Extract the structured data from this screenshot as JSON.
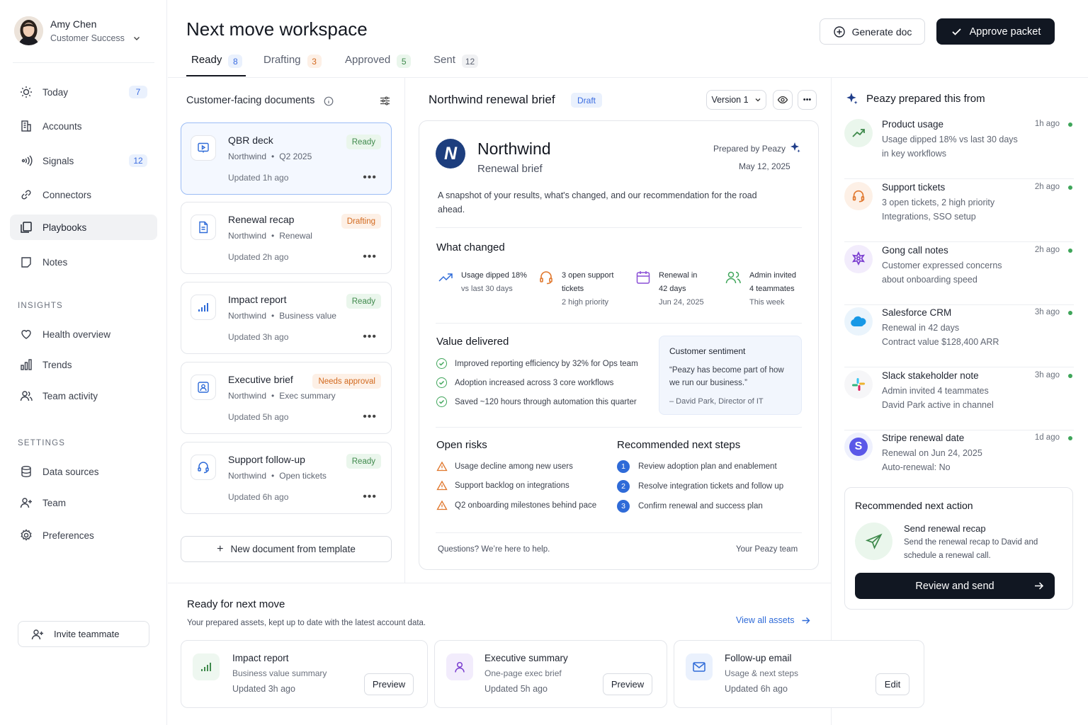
{
  "user": {
    "name": "Amy Chen",
    "role": "Customer Success"
  },
  "nav": {
    "items": [
      {
        "label": "Today",
        "badge": "7"
      },
      {
        "label": "Accounts"
      },
      {
        "label": "Signals",
        "badge": "12"
      },
      {
        "label": "Connectors"
      },
      {
        "label": "Playbooks"
      },
      {
        "label": "Notes"
      }
    ],
    "insights_label": "INSIGHTS",
    "insights": [
      {
        "label": "Health overview"
      },
      {
        "label": "Trends"
      },
      {
        "label": "Team activity"
      }
    ],
    "settings_label": "SETTINGS",
    "settings": [
      {
        "label": "Data sources"
      },
      {
        "label": "Team"
      },
      {
        "label": "Preferences"
      }
    ],
    "invite": "Invite teammate"
  },
  "header": {
    "title": "Next move workspace",
    "tabs": [
      {
        "label": "Ready",
        "count": "8"
      },
      {
        "label": "Drafting",
        "count": "3"
      },
      {
        "label": "Approved",
        "count": "5"
      },
      {
        "label": "Sent",
        "count": "12"
      }
    ],
    "generate_doc": "Generate doc",
    "approve_packet": "Approve packet"
  },
  "documents": {
    "title": "Customer-facing documents",
    "items": [
      {
        "title": "QBR deck",
        "account": "Northwind",
        "detail": "Q2 2025",
        "updated": "Updated 1h ago",
        "status": "Ready"
      },
      {
        "title": "Renewal recap",
        "account": "Northwind",
        "detail": "Renewal",
        "updated": "Updated 2h ago",
        "status": "Drafting"
      },
      {
        "title": "Impact report",
        "account": "Northwind",
        "detail": "Business value",
        "updated": "Updated 3h ago",
        "status": "Ready"
      },
      {
        "title": "Executive brief",
        "account": "Northwind",
        "detail": "Exec summary",
        "updated": "Updated 5h ago",
        "status": "Needs approval"
      },
      {
        "title": "Support follow-up",
        "account": "Northwind",
        "detail": "Open tickets",
        "updated": "Updated 6h ago",
        "status": "Ready"
      }
    ],
    "new_doc": "New document from template"
  },
  "brief": {
    "title": "Northwind renewal brief",
    "badge": "Draft",
    "version": "Version 1",
    "company": "Northwind",
    "company_initial": "N",
    "subtitle": "Renewal brief",
    "prepared_by": "Prepared by Peazy",
    "date": "May 12, 2025",
    "intro": "A snapshot of your results, what's changed, and our recommendation for the road ahead.",
    "what_changed_title": "What changed",
    "changes": [
      {
        "l1": "Usage dipped 18%",
        "l2": "vs last 30 days",
        "l3": ""
      },
      {
        "l1": "3 open support",
        "l2": "tickets",
        "l3": "2 high priority"
      },
      {
        "l1": "Renewal in",
        "l2": "42 days",
        "l3": "Jun 24, 2025"
      },
      {
        "l1": "Admin invited",
        "l2": "4 teammates",
        "l3": "This week"
      }
    ],
    "value_title": "Value delivered",
    "value": [
      "Improved reporting efficiency by 32% for Ops team",
      "Adoption increased across 3 core workflows",
      "Saved ~120 hours through automation this quarter"
    ],
    "sentiment_title": "Customer sentiment",
    "sentiment_quote_1": "“Peazy has become part of how",
    "sentiment_quote_2": "we run our business.”",
    "sentiment_author": "– David Park, Director of IT",
    "risks_title": "Open risks",
    "risks": [
      "Usage decline among new users",
      "Support backlog on integrations",
      "Q2 onboarding milestones behind pace"
    ],
    "steps_title": "Recommended next steps",
    "steps": [
      {
        "n": "1",
        "text": "Review adoption plan and enablement"
      },
      {
        "n": "2",
        "text": "Resolve integration tickets and follow up"
      },
      {
        "n": "3",
        "text": "Confirm renewal and success plan"
      }
    ],
    "footer_left": "Questions? We’re here to help.",
    "footer_right": "Your Peazy team"
  },
  "sources": {
    "title": "Peazy prepared this from",
    "items": [
      {
        "title": "Product usage",
        "l1": "Usage dipped 18% vs last 30 days",
        "l2": "in key workflows",
        "time": "1h ago"
      },
      {
        "title": "Support tickets",
        "l1": "3 open tickets, 2 high priority",
        "l2": "Integrations, SSO setup",
        "time": "2h ago"
      },
      {
        "title": "Gong call notes",
        "l1": "Customer expressed concerns",
        "l2": "about onboarding speed",
        "time": "2h ago"
      },
      {
        "title": "Salesforce CRM",
        "l1": "Renewal in 42 days",
        "l2": "Contract value $128,400 ARR",
        "time": "3h ago"
      },
      {
        "title": "Slack stakeholder note",
        "l1": "Admin invited 4 teammates",
        "l2": "David Park active in channel",
        "time": "3h ago"
      },
      {
        "title": "Stripe renewal date",
        "l1": "Renewal on Jun 24, 2025",
        "l2": "Auto-renewal: No",
        "time": "1d ago"
      }
    ],
    "stripe_letter": "S"
  },
  "recommended": {
    "title": "Recommended next action",
    "action_title": "Send renewal recap",
    "action_l1": "Send the renewal recap to David and",
    "action_l2": "schedule a renewal call.",
    "button": "Review and send"
  },
  "ready": {
    "title": "Ready for next move",
    "subtitle": "Your prepared assets, kept up to date with the latest account data.",
    "view_all": "View all assets",
    "assets": [
      {
        "title": "Impact report",
        "sub": "Business value summary",
        "updated": "Updated 3h ago",
        "action": "Preview"
      },
      {
        "title": "Executive summary",
        "sub": "One-page exec brief",
        "updated": "Updated 5h ago",
        "action": "Preview"
      },
      {
        "title": "Follow-up email",
        "sub": "Usage & next steps",
        "updated": "Updated 6h ago",
        "action": "Edit"
      }
    ]
  },
  "colors": {
    "accent": "#2f6bd8",
    "dark_button": "#111722",
    "ready": "#3f8a4c",
    "drafting": "#d2691e",
    "success": "#3fa55a",
    "warning": "#e0762b"
  }
}
